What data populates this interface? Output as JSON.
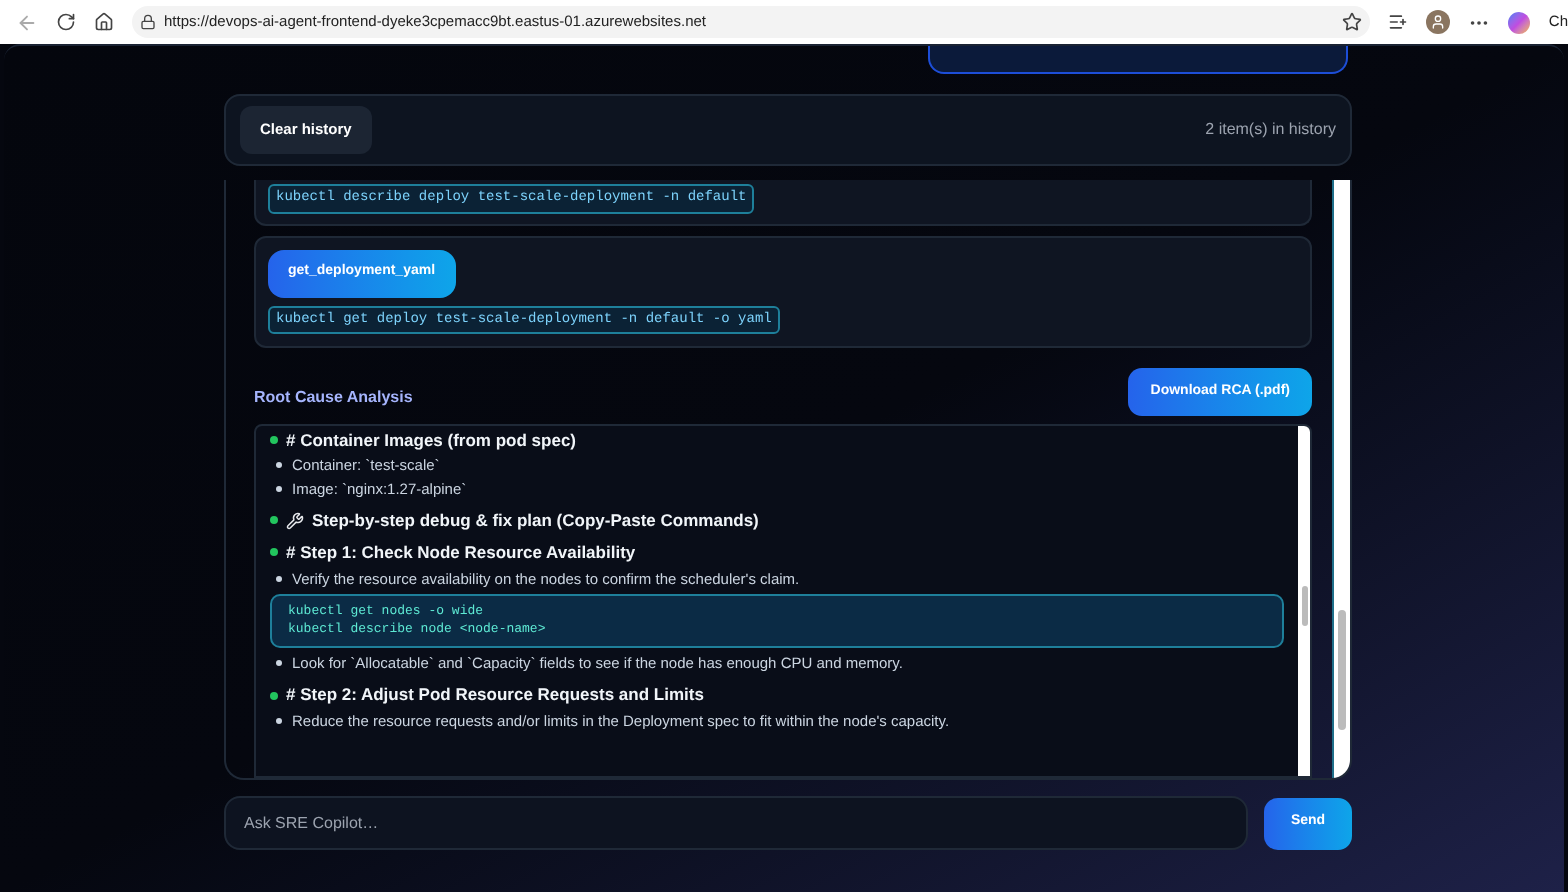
{
  "browser": {
    "url": "https://devops-ai-agent-frontend-dyeke3cpemacc9bt.eastus-01.azurewebsites.net",
    "edge_label": "Ch"
  },
  "history": {
    "button": "Clear history",
    "count": "2 item(s) in history"
  },
  "tool_calls": [
    {
      "command": "kubectl describe deploy test-scale-deployment -n default"
    },
    {
      "name": "get_deployment_yaml",
      "command": "kubectl get deploy test-scale-deployment -n default -o yaml"
    }
  ],
  "rca": {
    "title": "Root Cause Analysis",
    "download": "Download RCA (.pdf)",
    "blocks": [
      {
        "kind": "heading",
        "text": "# Container Images (from pod spec)"
      },
      {
        "kind": "bullet",
        "text": "Container: `test-scale`"
      },
      {
        "kind": "bullet",
        "text": "Image: `nginx:1.27-alpine`"
      },
      {
        "kind": "tool_heading",
        "text": "Step-by-step debug & fix plan (Copy-Paste Commands)"
      },
      {
        "kind": "heading",
        "text": "# Step 1: Check Node Resource Availability"
      },
      {
        "kind": "bullet",
        "text": "Verify the resource availability on the nodes to confirm the scheduler's claim."
      },
      {
        "kind": "code",
        "lines": [
          "kubectl get nodes -o wide",
          "kubectl describe node <node-name>"
        ]
      },
      {
        "kind": "bullet",
        "text": "Look for `Allocatable` and `Capacity` fields to see if the node has enough CPU and memory."
      },
      {
        "kind": "heading",
        "text": "# Step 2: Adjust Pod Resource Requests and Limits"
      },
      {
        "kind": "bullet",
        "text": "Reduce the resource requests and/or limits in the Deployment spec to fit within the node's capacity."
      }
    ]
  },
  "composer": {
    "placeholder": "Ask SRE Copilot…",
    "send": "Send"
  }
}
